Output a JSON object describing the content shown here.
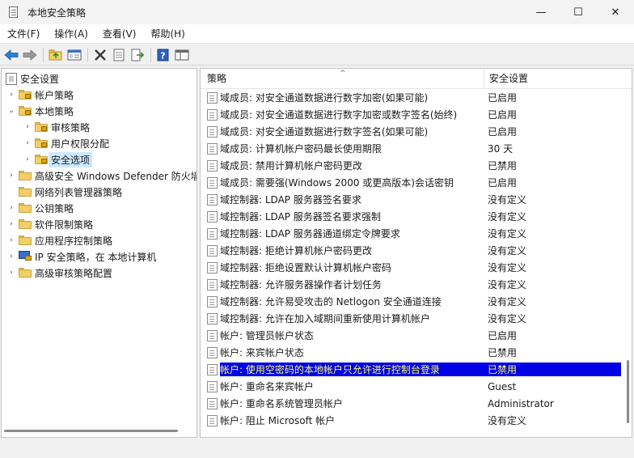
{
  "window": {
    "title": "本地安全策略",
    "minimize_glyph": "—",
    "maximize_glyph": "☐",
    "close_glyph": "✕"
  },
  "menu": {
    "items": [
      {
        "label": "文件(F)"
      },
      {
        "label": "操作(A)"
      },
      {
        "label": "查看(V)"
      },
      {
        "label": "帮助(H)"
      }
    ]
  },
  "toolbar": {
    "buttons": [
      "back-icon",
      "forward-icon",
      "up-folder-icon",
      "show-hide-tree-icon",
      "delete-icon",
      "properties-icon",
      "export-list-icon",
      "help-icon",
      "mmc-pane-icon"
    ]
  },
  "tree": {
    "items": [
      {
        "label": "安全设置",
        "icon": "security-settings-icon",
        "level": 0,
        "twisty": ""
      },
      {
        "label": "帐户策略",
        "icon": "folder-lock-icon",
        "level": 1,
        "twisty": "›"
      },
      {
        "label": "本地策略",
        "icon": "folder-lock-icon",
        "level": 1,
        "twisty": "⌄"
      },
      {
        "label": "审核策略",
        "icon": "folder-lock-icon",
        "level": 2,
        "twisty": "›"
      },
      {
        "label": "用户权限分配",
        "icon": "folder-lock-icon",
        "level": 2,
        "twisty": "›"
      },
      {
        "label": "安全选项",
        "icon": "folder-lock-icon",
        "level": 2,
        "twisty": "›",
        "selected": true
      },
      {
        "label": "高级安全 Windows Defender 防火墙",
        "icon": "folder-icon",
        "level": 1,
        "twisty": "›"
      },
      {
        "label": "网络列表管理器策略",
        "icon": "folder-icon",
        "level": 1,
        "twisty": ""
      },
      {
        "label": "公钥策略",
        "icon": "folder-icon",
        "level": 1,
        "twisty": "›"
      },
      {
        "label": "软件限制策略",
        "icon": "folder-icon",
        "level": 1,
        "twisty": "›"
      },
      {
        "label": "应用程序控制策略",
        "icon": "folder-icon",
        "level": 1,
        "twisty": "›"
      },
      {
        "label": "IP 安全策略，在 本地计算机",
        "icon": "ip-security-icon",
        "level": 1,
        "twisty": "›"
      },
      {
        "label": "高级审核策略配置",
        "icon": "folder-icon",
        "level": 1,
        "twisty": "›"
      }
    ]
  },
  "list": {
    "columns": {
      "policy": "策略",
      "setting": "安全设置"
    },
    "sort_glyph": "^",
    "rows": [
      {
        "policy": "域成员: 对安全通道数据进行数字加密(如果可能)",
        "setting": "已启用"
      },
      {
        "policy": "域成员: 对安全通道数据进行数字加密或数字签名(始终)",
        "setting": "已启用"
      },
      {
        "policy": "域成员: 对安全通道数据进行数字签名(如果可能)",
        "setting": "已启用"
      },
      {
        "policy": "域成员: 计算机帐户密码最长使用期限",
        "setting": "30 天"
      },
      {
        "policy": "域成员: 禁用计算机帐户密码更改",
        "setting": "已禁用"
      },
      {
        "policy": "域成员: 需要强(Windows 2000 或更高版本)会话密钥",
        "setting": "已启用"
      },
      {
        "policy": "域控制器: LDAP 服务器签名要求",
        "setting": "没有定义"
      },
      {
        "policy": "域控制器: LDAP 服务器签名要求强制",
        "setting": "没有定义"
      },
      {
        "policy": "域控制器: LDAP 服务器通道绑定令牌要求",
        "setting": "没有定义"
      },
      {
        "policy": "域控制器: 拒绝计算机帐户密码更改",
        "setting": "没有定义"
      },
      {
        "policy": "域控制器:  拒绝设置默认计算机帐户密码",
        "setting": "没有定义"
      },
      {
        "policy": "域控制器: 允许服务器操作者计划任务",
        "setting": "没有定义"
      },
      {
        "policy": "域控制器: 允许易受攻击的 Netlogon 安全通道连接",
        "setting": "没有定义"
      },
      {
        "policy": "域控制器:   允许在加入域期间重新使用计算机帐户",
        "setting": "没有定义"
      },
      {
        "policy": "帐户: 管理员帐户状态",
        "setting": "已启用"
      },
      {
        "policy": "帐户: 来宾帐户状态",
        "setting": "已禁用"
      },
      {
        "policy": "帐户: 使用空密码的本地帐户只允许进行控制台登录",
        "setting": "已禁用",
        "selected": true
      },
      {
        "policy": "帐户: 重命名来宾帐户",
        "setting": "Guest"
      },
      {
        "policy": "帐户: 重命名系统管理员帐户",
        "setting": "Administrator"
      },
      {
        "policy": "帐户: 阻止 Microsoft 帐户",
        "setting": "没有定义"
      }
    ]
  },
  "colors": {
    "selection_background": "#0000e6",
    "selection_text": "#ffff66",
    "tree_selection": "#cce8ff",
    "folder": "#f2cf66"
  }
}
